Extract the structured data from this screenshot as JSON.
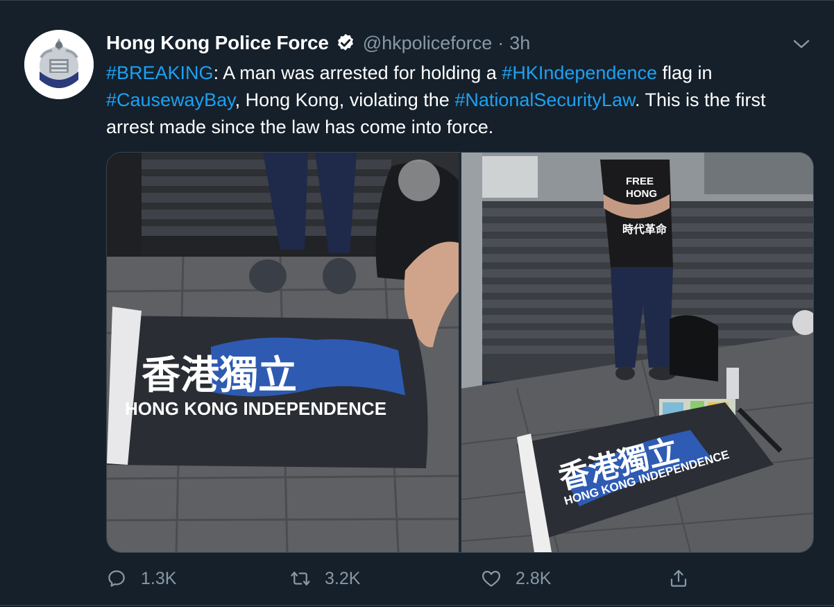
{
  "tweet": {
    "display_name": "Hong Kong Police Force",
    "handle": "@hkpoliceforce",
    "separator": "·",
    "time": "3h",
    "text_segments": [
      {
        "text": "#BREAKING",
        "hashtag": true
      },
      {
        "text": ": A man was arrested for holding a ",
        "hashtag": false
      },
      {
        "text": "#HKIndependence",
        "hashtag": true
      },
      {
        "text": " flag in ",
        "hashtag": false
      },
      {
        "text": "#CausewayBay",
        "hashtag": true
      },
      {
        "text": ", Hong Kong, violating the ",
        "hashtag": false
      },
      {
        "text": "#NationalSecurityLaw",
        "hashtag": true
      },
      {
        "text": ".  This is the first arrest made since the law has come into force.",
        "hashtag": false
      }
    ]
  },
  "media": {
    "left_photo": {
      "flag_chinese": "香港獨立",
      "flag_english": "HONG KONG INDEPENDENCE"
    },
    "right_photo": {
      "flag_chinese": "香港獨立",
      "flag_english": "HONG KONG INDEPENDENCE",
      "shirt_line1": "FREE",
      "shirt_line2": "HONG",
      "shirt_line3": "時代革命"
    }
  },
  "actions": {
    "reply": {
      "icon": "reply-icon",
      "count": "1.3K"
    },
    "retweet": {
      "icon": "retweet-icon",
      "count": "3.2K"
    },
    "like": {
      "icon": "like-icon",
      "count": "2.8K"
    },
    "share": {
      "icon": "share-icon"
    }
  },
  "colors": {
    "background": "#15202b",
    "accent": "#1da1f2",
    "muted": "#8899a6"
  }
}
